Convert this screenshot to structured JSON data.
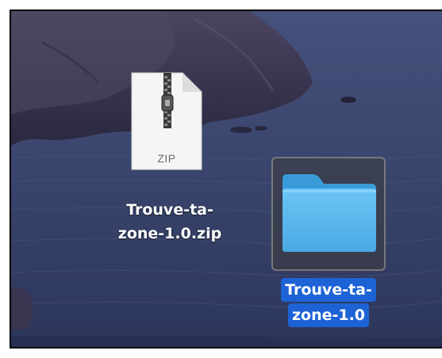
{
  "desktop": {
    "items": [
      {
        "name_line1": "Trouve-ta-",
        "name_line2": "zone-1.0.zip",
        "icon": "zip-archive-icon",
        "icon_label": "ZIP",
        "selected": false
      },
      {
        "name_line1": "Trouve-ta-",
        "name_line2": "zone-1.0",
        "icon": "folder-icon",
        "selected": true
      }
    ]
  },
  "colors": {
    "selection_highlight": "#1d63d6",
    "folder_blue": "#5ab8ef",
    "sea": "#36416a"
  }
}
